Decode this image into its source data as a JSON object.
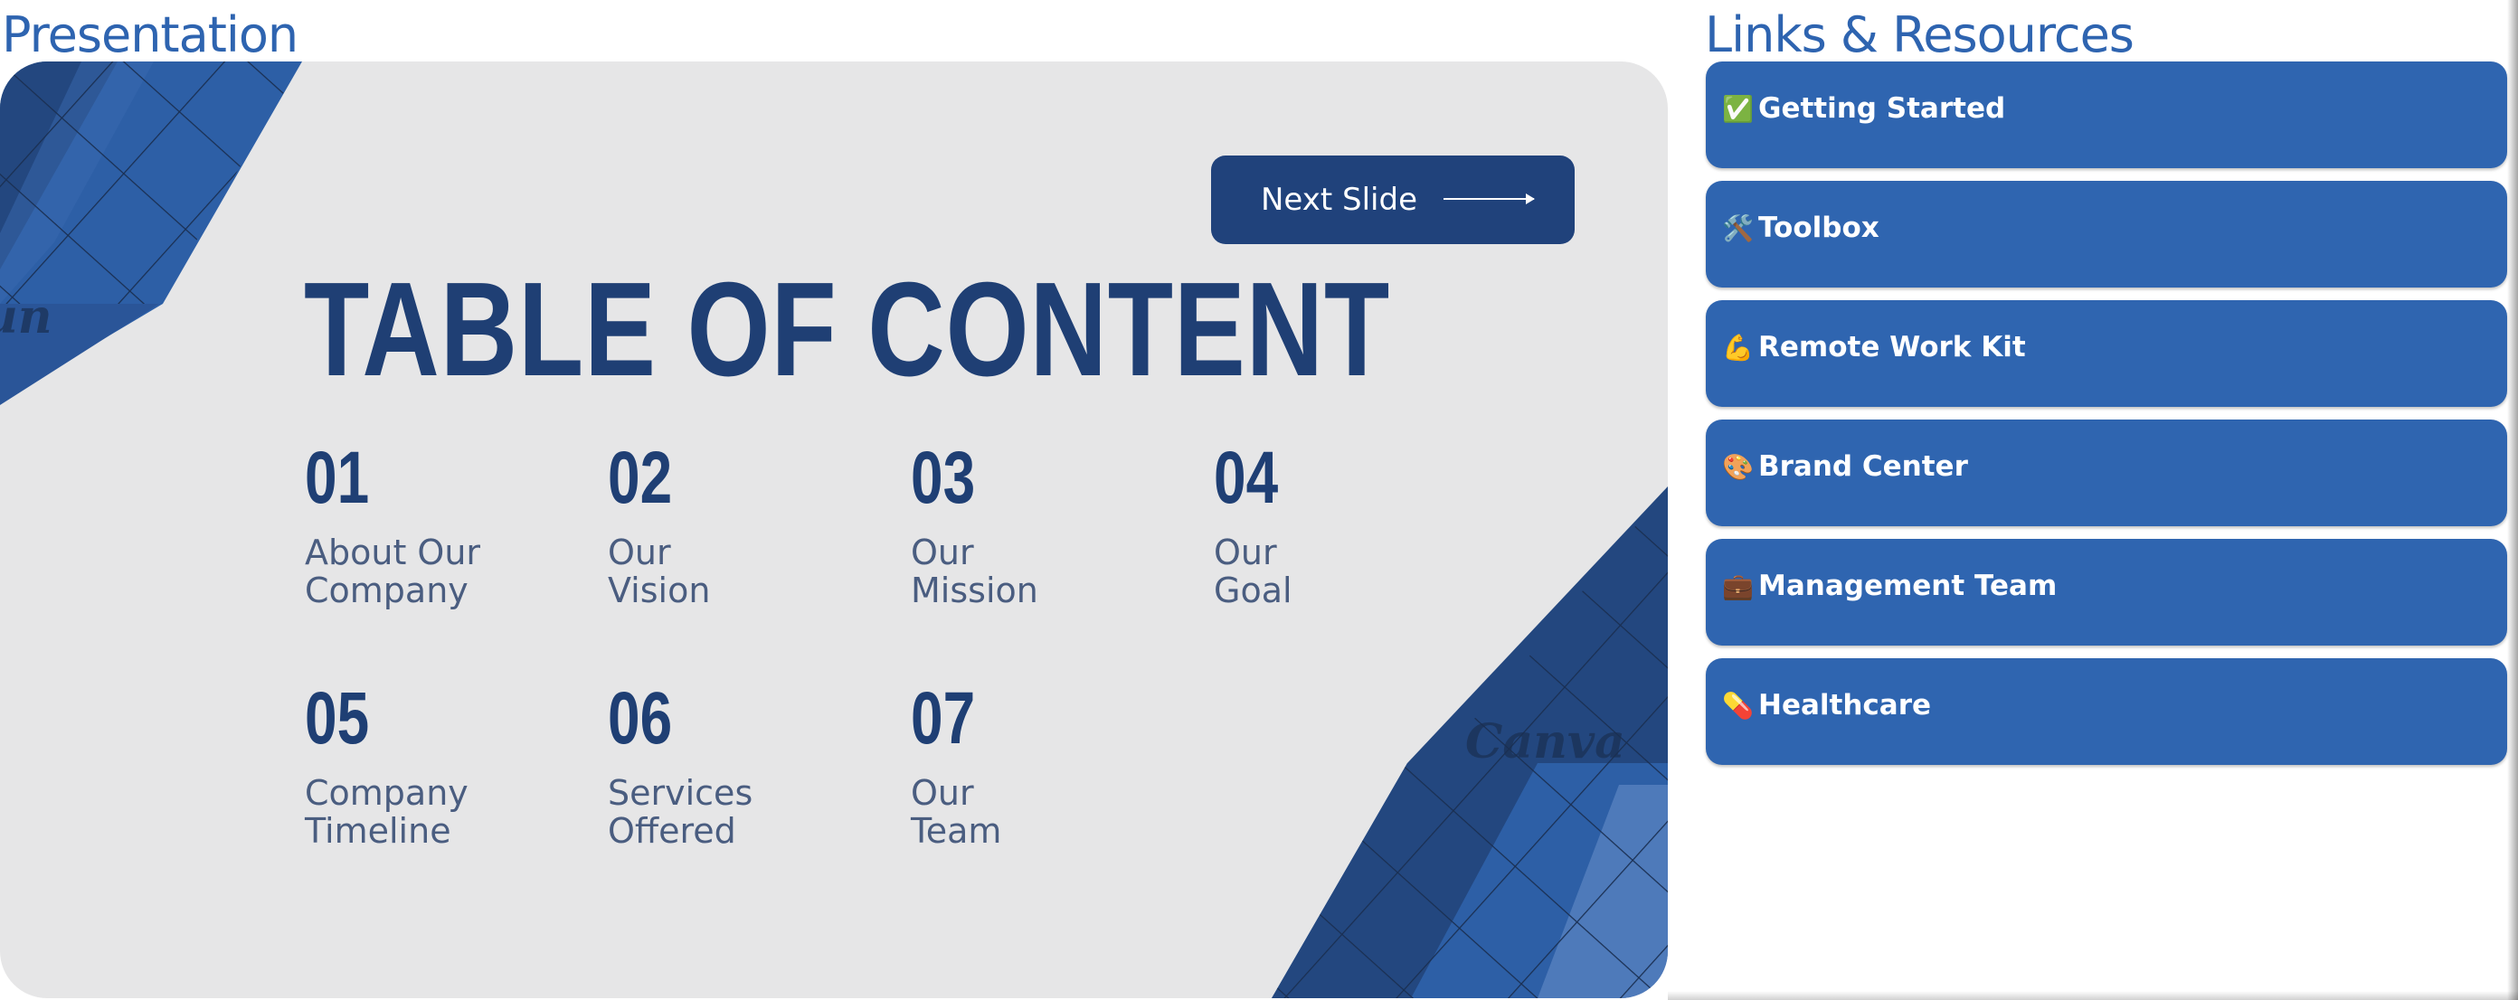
{
  "presentation": {
    "section_title": "Presentation",
    "slide": {
      "heading": "TABLE OF CONTENT",
      "next_button_label": "Next Slide",
      "watermark": "Canva",
      "items": [
        {
          "number": "01",
          "label": "About Our Company"
        },
        {
          "number": "02",
          "label": "Our Vision"
        },
        {
          "number": "03",
          "label": "Our Mission"
        },
        {
          "number": "04",
          "label": "Our Goal"
        },
        {
          "number": "05",
          "label": "Company Timeline"
        },
        {
          "number": "06",
          "label": "Services Offered"
        },
        {
          "number": "07",
          "label": "Our Team"
        }
      ]
    }
  },
  "links_panel": {
    "section_title": "Links & Resources",
    "items": [
      {
        "emoji": "✅",
        "icon": "check-icon",
        "label": "Getting Started"
      },
      {
        "emoji": "🛠️",
        "icon": "toolbox-icon",
        "label": "Toolbox"
      },
      {
        "emoji": "💪",
        "icon": "muscle-icon",
        "label": "Remote Work Kit"
      },
      {
        "emoji": "🎨",
        "icon": "palette-icon",
        "label": "Brand Center"
      },
      {
        "emoji": "💼",
        "icon": "briefcase-icon",
        "label": "Management Team"
      },
      {
        "emoji": "💊",
        "icon": "pill-icon",
        "label": "Healthcare"
      }
    ]
  },
  "colors": {
    "title_blue": "#2e64b0",
    "slide_background": "#e6e6e7",
    "slide_navy": "#1f3f74",
    "card_blue": "#2f65b0"
  }
}
